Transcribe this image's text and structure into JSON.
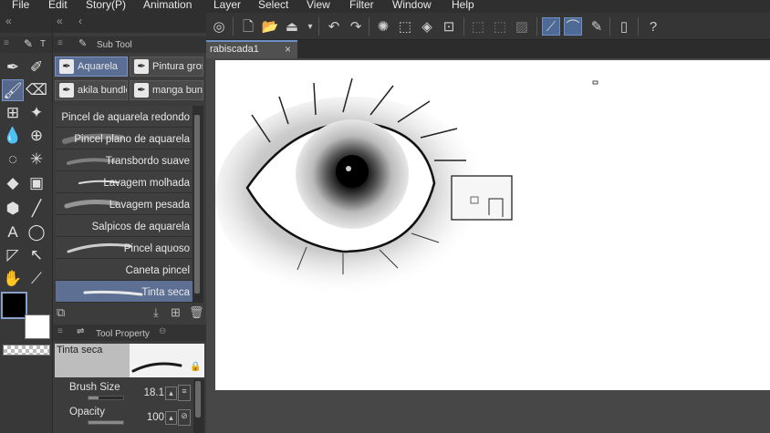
{
  "menu": [
    "File",
    "Edit",
    "Story(P)",
    "Animation",
    "Layer",
    "Select",
    "View",
    "Filter",
    "Window",
    "Help"
  ],
  "document_tab": {
    "label": "rabiscada1",
    "close": "×"
  },
  "tool_panel_tab": "T",
  "sub_tool": {
    "header": "Sub Tool",
    "groups": [
      "Aquarela",
      "Pintura grossa",
      "akila bundle",
      "manga bundle"
    ],
    "brushes": [
      "Pincel de aquarela redondo",
      "Pincel plano de aquarela",
      "Transbordo suave",
      "Lavagem molhada",
      "Lavagem pesada",
      "Salpicos de aquarela",
      "Pincel aquoso",
      "Caneta pincel",
      "Tinta seca"
    ],
    "selected_brush": "Tinta seca"
  },
  "tool_property": {
    "header": "Tool Property",
    "preview_name": "Tinta seca",
    "brush_size_label": "Brush Size",
    "brush_size_value": "18.1",
    "opacity_label": "Opacity",
    "opacity_value": "100",
    "brush_size_fraction": 0.3,
    "opacity_fraction": 1.0
  },
  "colors": {
    "main": "#000000",
    "sub": "#ffffff",
    "accent": "#56698c"
  }
}
